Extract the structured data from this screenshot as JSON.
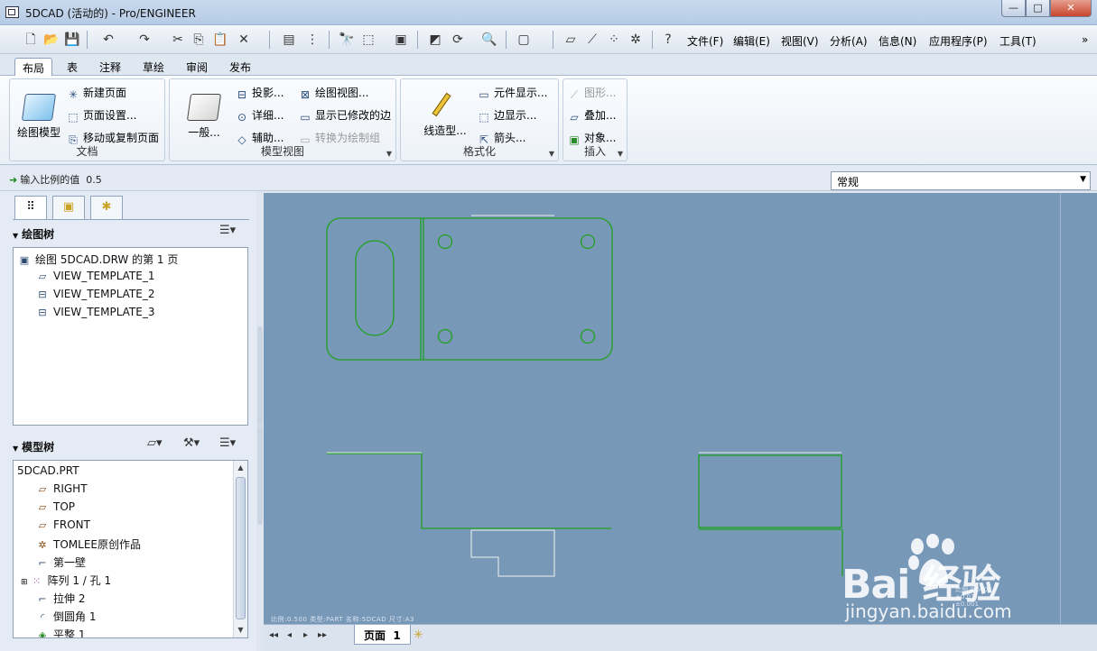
{
  "window": {
    "title": "5DCAD (活动的) - Pro/ENGINEER",
    "minimize": "—",
    "maximize": "□",
    "close": "✕"
  },
  "menu": [
    {
      "id": "file",
      "label": "文件(F)"
    },
    {
      "id": "edit",
      "label": "编辑(E)"
    },
    {
      "id": "view",
      "label": "视图(V)"
    },
    {
      "id": "analysis",
      "label": "分析(A)"
    },
    {
      "id": "info",
      "label": "信息(N)"
    },
    {
      "id": "apps",
      "label": "应用程序(P)"
    },
    {
      "id": "tools",
      "label": "工具(T)"
    }
  ],
  "menu_more": "»",
  "tabs": [
    {
      "id": "layout",
      "label": "布局",
      "active": true
    },
    {
      "id": "table",
      "label": "表"
    },
    {
      "id": "annotate",
      "label": "注释"
    },
    {
      "id": "sketch",
      "label": "草绘"
    },
    {
      "id": "review",
      "label": "审阅"
    },
    {
      "id": "publish",
      "label": "发布"
    }
  ],
  "ribbon": {
    "document": {
      "label": "文档",
      "big": "绘图模型",
      "items": [
        "新建页面",
        "页面设置...",
        "移动或复制页面"
      ]
    },
    "model_views": {
      "label": "模型视图",
      "big": "一般...",
      "col1": [
        "投影...",
        "详细...",
        "辅助..."
      ],
      "col2": [
        "绘图视图...",
        "显示已修改的边",
        "转换为绘制组"
      ]
    },
    "format": {
      "label": "格式化",
      "big": "线造型...",
      "items": [
        "元件显示...",
        "边显示...",
        "箭头..."
      ]
    },
    "insert": {
      "label": "插入",
      "items": [
        "图形...",
        "叠加...",
        "对象..."
      ]
    }
  },
  "status": {
    "message": "输入比例的值",
    "value": "0.5",
    "filter": "常规"
  },
  "drawing_tree": {
    "title": "绘图树",
    "root": "绘图 5DCAD.DRW 的第 1 页",
    "items": [
      "VIEW_TEMPLATE_1",
      "VIEW_TEMPLATE_2",
      "VIEW_TEMPLATE_3"
    ]
  },
  "model_tree": {
    "title": "模型树",
    "root": "5DCAD.PRT",
    "items": [
      {
        "label": "RIGHT",
        "icon": "datum-plane-icon"
      },
      {
        "label": "TOP",
        "icon": "datum-plane-icon"
      },
      {
        "label": "FRONT",
        "icon": "datum-plane-icon"
      },
      {
        "label": "TOMLEE原创作品",
        "icon": "coordinate-system-icon"
      },
      {
        "label": "第一壁",
        "icon": "sheetmetal-wall-icon"
      },
      {
        "label": "阵列 1 / 孔 1",
        "icon": "pattern-icon"
      },
      {
        "label": "拉伸 2",
        "icon": "extrude-icon"
      },
      {
        "label": "倒圆角 1",
        "icon": "round-icon"
      },
      {
        "label": "平整 1",
        "icon": "flat-wall-icon"
      }
    ]
  },
  "canvas": {
    "stamp": "比例:0.500   类型:PART   名称:5DCAD   尺寸:A3",
    "stamp_right": [
      "比例 0.500",
      "±0.01",
      "±0.001"
    ]
  },
  "pagebar": {
    "page_label": "页面",
    "page_number": "1"
  },
  "watermark": {
    "brand": "Bai  经验",
    "url": "jingyan.baidu.com"
  },
  "colors": {
    "canvas": "#7898b8",
    "geometry": "#1fa01f",
    "accent": "#1a8a1a"
  }
}
